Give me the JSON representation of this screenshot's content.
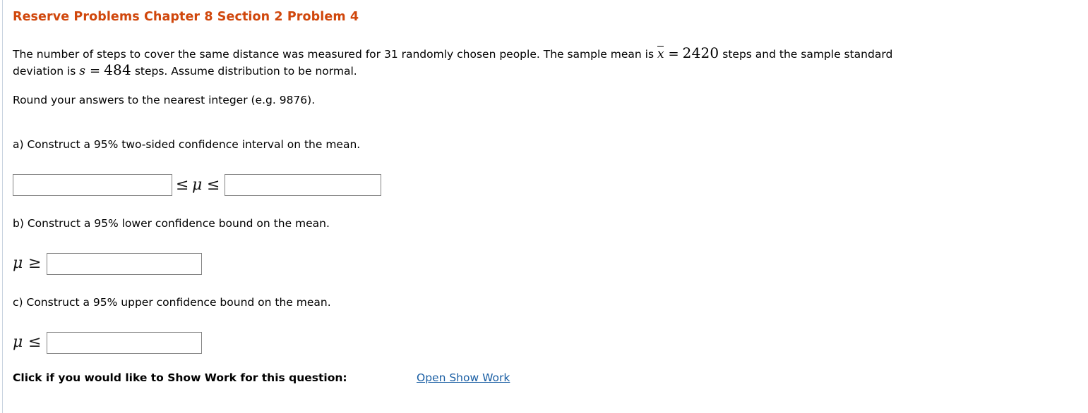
{
  "problem": {
    "title": "Reserve Problems Chapter 8 Section 2 Problem 4",
    "title_color": "#d0470c",
    "statement": {
      "line1_part1": "The number of steps to cover the same distance was measured for 31 randomly chosen people. The sample mean is ",
      "math_xbar_symbol": "x",
      "math_equals": "=",
      "math_xbar_value": "2420",
      "line1_part2": " steps and the sample standard",
      "line2_part1": "deviation is ",
      "math_s_symbol": "s",
      "math_s_value": "484",
      "line2_part2": " steps. Assume distribution to be normal."
    },
    "rounding_note": "Round your answers to the nearest integer (e.g. 9876).",
    "parts": [
      {
        "id": "a",
        "prompt": "a) Construct a 95% two-sided confidence interval on the mean.",
        "answer_type": "interval",
        "lower_value": "",
        "upper_value": "",
        "left_relation": "≤",
        "variable": "μ",
        "right_relation": "≤"
      },
      {
        "id": "b",
        "prompt": "b) Construct a 95% lower confidence bound on the mean.",
        "answer_type": "bound",
        "variable": "μ",
        "relation": "≥",
        "value": ""
      },
      {
        "id": "c",
        "prompt": "c) Construct a 95% upper confidence bound on the mean.",
        "answer_type": "bound",
        "variable": "μ",
        "relation": "≤",
        "value": ""
      }
    ]
  },
  "show_work": {
    "label": "Click if you would like to Show Work for this question:",
    "link_text": "Open Show Work",
    "link_color": "#1b5fa4"
  },
  "icons": {
    "left_rule": "vertical-divider"
  }
}
